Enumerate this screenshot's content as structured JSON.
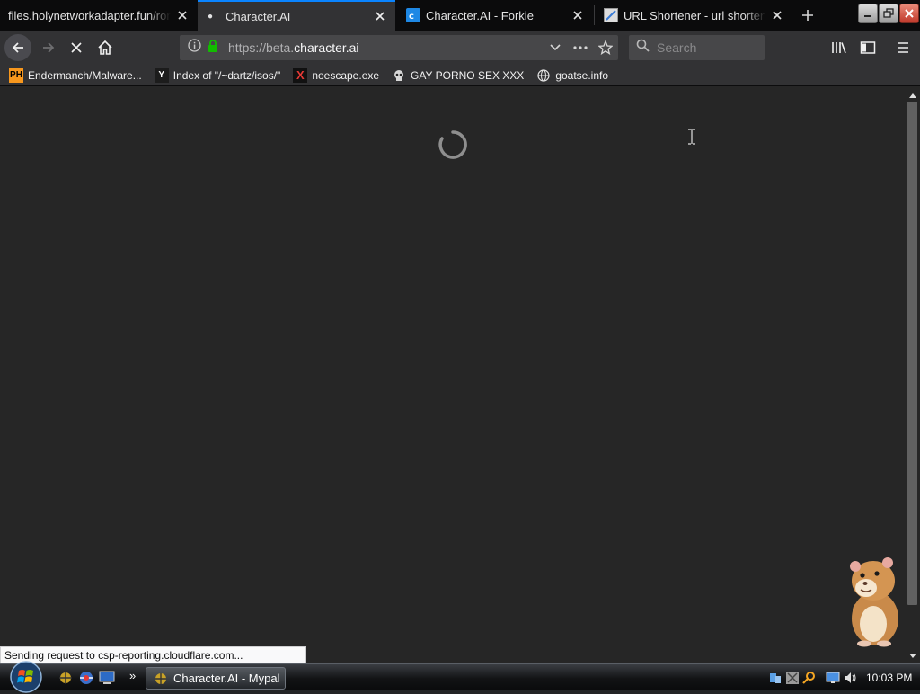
{
  "browser": {
    "tabs": [
      {
        "title": "files.holynetworkadapter.fun/ronc",
        "active": false
      },
      {
        "title": "Character.AI",
        "active": true
      },
      {
        "title": "Character.AI - Forkie",
        "active": false
      },
      {
        "title": "URL Shortener - url shortening",
        "active": false
      }
    ],
    "url": {
      "prefix": "https://beta.",
      "domain": "character.ai"
    },
    "search_placeholder": "Search",
    "bookmarks": [
      {
        "label": "Endermanch/Malware...",
        "icon": "PH"
      },
      {
        "label": "Index of \"/~dartz/isos/\"",
        "icon": "Y"
      },
      {
        "label": "noescape.exe",
        "icon": "X"
      },
      {
        "label": "GAY PORNO SEX XXX",
        "icon": "skull-icon"
      },
      {
        "label": "goatse.info",
        "icon": "globe-icon"
      }
    ],
    "status_text": "Sending request to csp-reporting.cloudflare.com..."
  },
  "taskbar": {
    "task_button": "Character.AI - Mypal",
    "clock": "10:03 PM",
    "quicklaunch_more": "»"
  },
  "colors": {
    "accent": "#0a84ff",
    "toolbar": "#323234",
    "content": "#262626"
  }
}
